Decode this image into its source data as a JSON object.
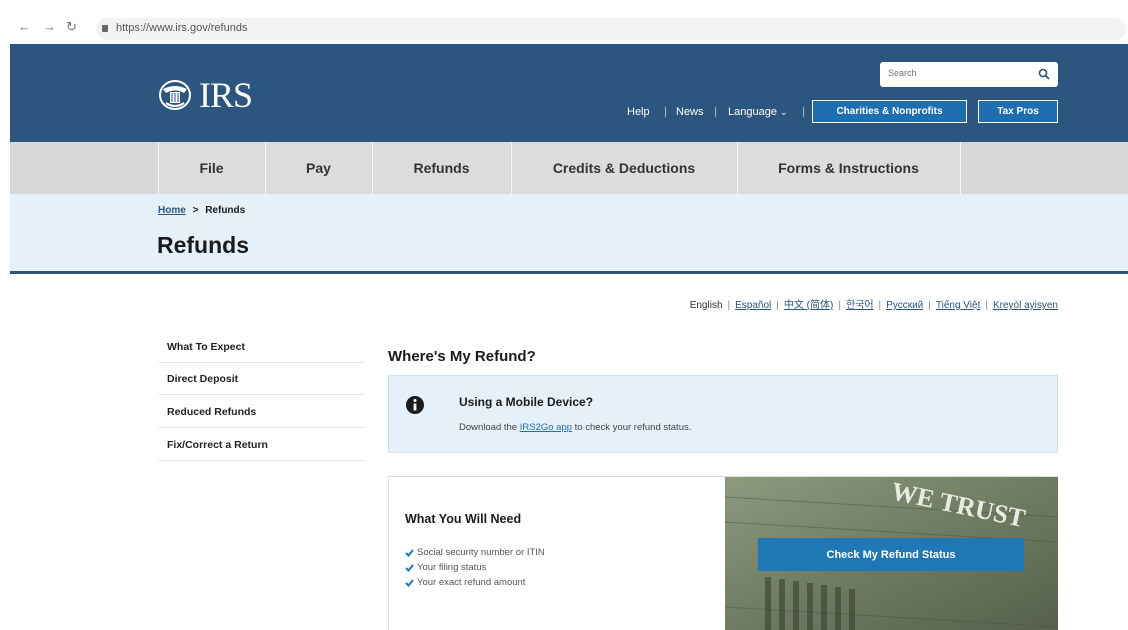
{
  "browser": {
    "url": "https://www.irs.gov/refunds"
  },
  "header": {
    "logo_text": "IRS",
    "search_placeholder": "Search",
    "util_links": [
      "Help",
      "News",
      "Language"
    ],
    "buttons": [
      "Charities & Nonprofits",
      "Tax Pros"
    ]
  },
  "menu": {
    "items": [
      "File",
      "Pay",
      "Refunds",
      "Credits & Deductions",
      "Forms & Instructions"
    ]
  },
  "breadcrumb": {
    "home": "Home",
    "separator": ">",
    "current": "Refunds"
  },
  "page": {
    "title": "Refunds"
  },
  "languages": [
    "English",
    "Español",
    "中文 (简体)",
    "한국어",
    "Русский",
    "Tiếng Việt",
    "Kreyòl ayisyen"
  ],
  "sidebar": {
    "items": [
      "What To Expect",
      "Direct Deposit",
      "Reduced Refunds",
      "Fix/Correct a Return"
    ]
  },
  "main": {
    "heading": "Where's My Refund?",
    "alert": {
      "title": "Using a Mobile Device?",
      "body_pre": "Download the ",
      "link": "IRS2Go app",
      "body_post": " to check your refund status."
    },
    "card": {
      "title": "What You Will Need",
      "items": [
        "Social security number or ITIN",
        "Your filing status",
        "Your exact refund amount"
      ],
      "cta": "Check My Refund Status",
      "image_text": "WE TRUST"
    }
  },
  "colors": {
    "header_blue": "#2c557f",
    "button_blue": "#1f6fb0",
    "light_blue": "#e5f0f8",
    "menu_gray": "#dcdcdc"
  }
}
